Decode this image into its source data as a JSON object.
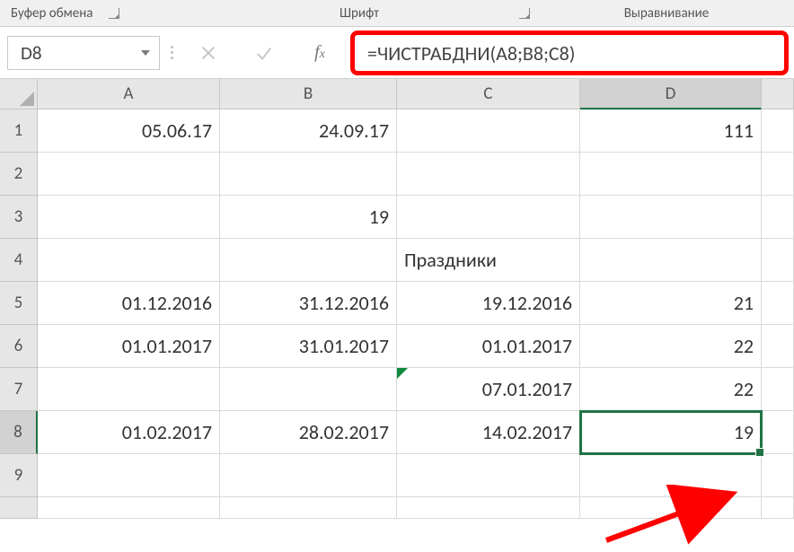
{
  "ribbon": {
    "clipboard": "Буфер обмена",
    "font": "Шрифт",
    "alignment": "Выравнивание"
  },
  "formula_bar": {
    "name_box": "D8",
    "formula": "=ЧИСТРАБДНИ(A8;B8;C8)"
  },
  "columns": [
    "A",
    "B",
    "C",
    "D"
  ],
  "row_numbers": [
    "1",
    "2",
    "3",
    "4",
    "5",
    "6",
    "7",
    "8",
    "9"
  ],
  "cells": {
    "A1": "05.06.17",
    "B1": "24.09.17",
    "D1": "111",
    "B3": "19",
    "C4": "Праздники",
    "A5": "01.12.2016",
    "B5": "31.12.2016",
    "C5": "19.12.2016",
    "D5": "21",
    "A6": "01.01.2017",
    "B6": "31.01.2017",
    "C6": "01.01.2017",
    "D6": "22",
    "C7": "07.01.2017",
    "D7": "22",
    "A8": "01.02.2017",
    "B8": "28.02.2017",
    "C8": "14.02.2017",
    "D8": "19"
  },
  "active_cell": "D8"
}
